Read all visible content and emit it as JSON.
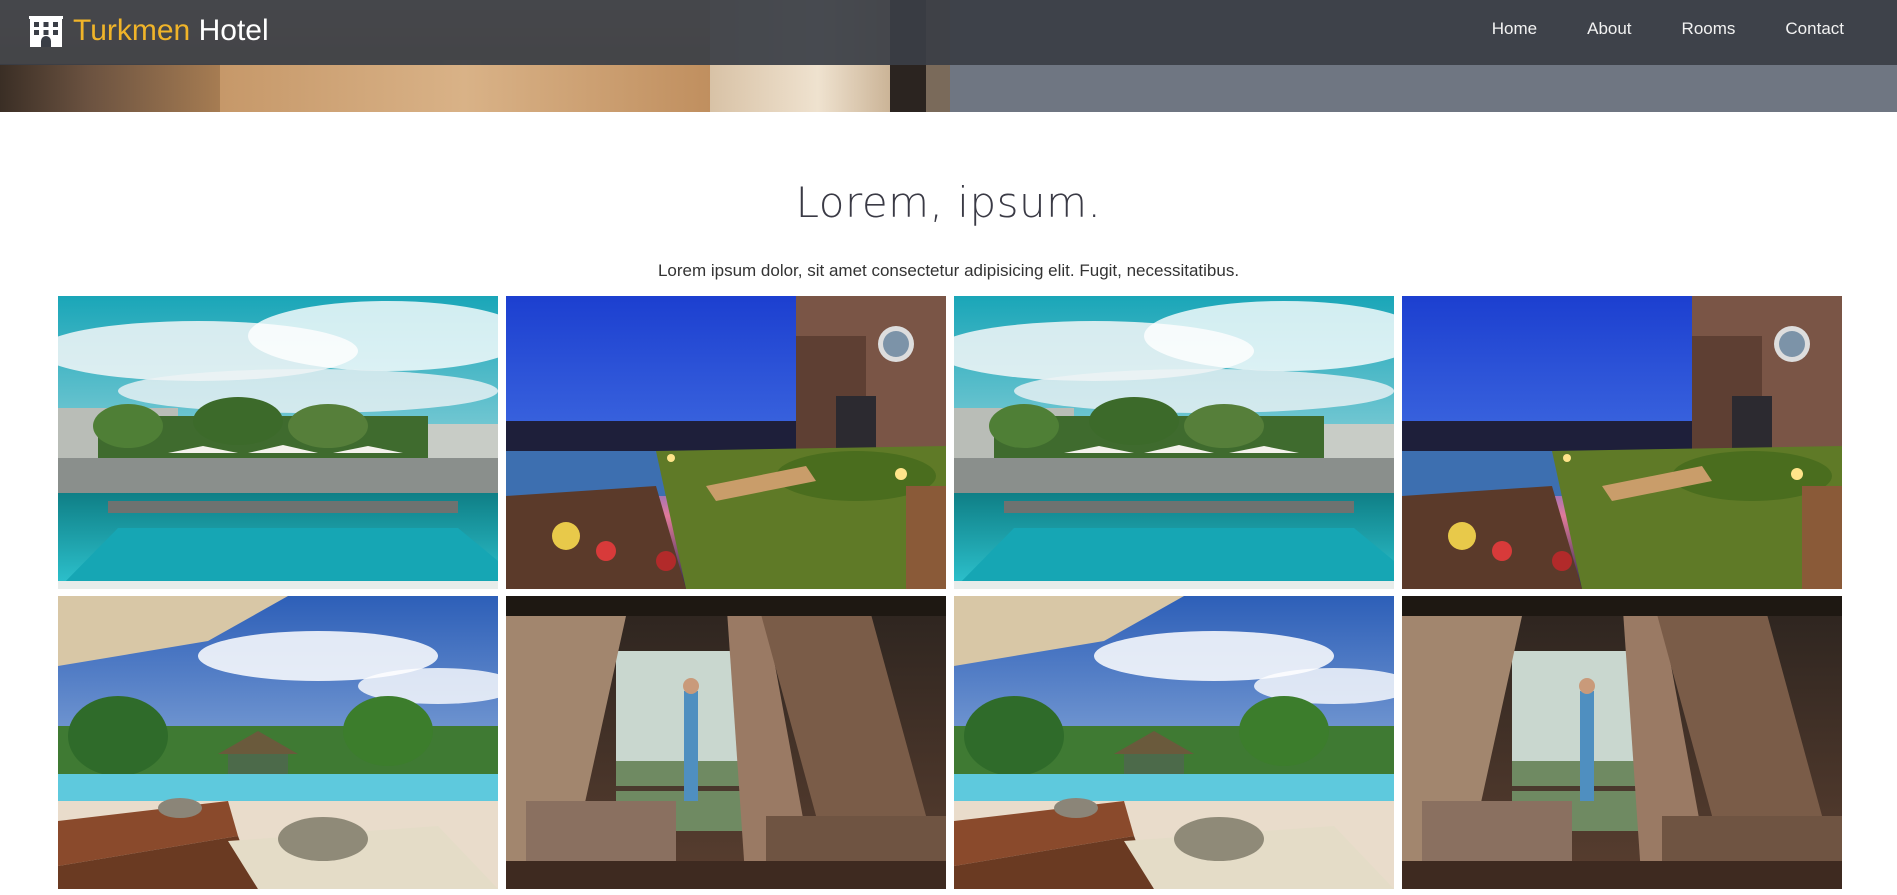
{
  "brand": {
    "accent": "Turkmen",
    "name": "Hotel",
    "icon": "hotel-building-icon",
    "accent_color": "#f0b429"
  },
  "nav": {
    "items": [
      "Home",
      "About",
      "Rooms",
      "Contact"
    ]
  },
  "section": {
    "title": "Lorem, ipsum.",
    "subtitle": "Lorem ipsum dolor, sit amet consectetur adipisicing elit. Fugit, necessitatibus."
  },
  "gallery": {
    "tiles": [
      "pool-day",
      "villa-night",
      "pool-day",
      "villa-night",
      "beach-pool",
      "canopy-room",
      "beach-pool",
      "canopy-room"
    ]
  }
}
